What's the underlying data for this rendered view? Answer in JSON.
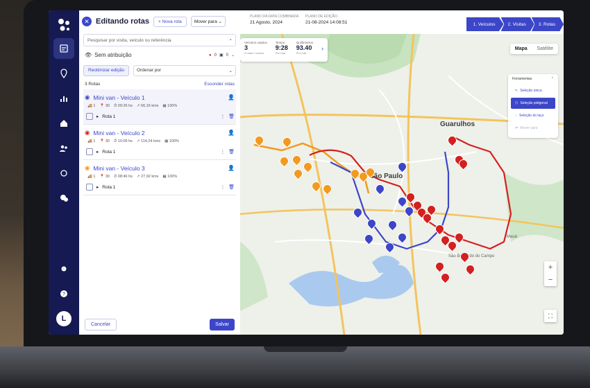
{
  "app": {
    "title": "Editando rotas",
    "new_route_button": "+ Nova rota",
    "move_to_select": "Mover para",
    "plan_name_label": "PLANO DA DATA COMBINADA",
    "plan_date": "21 Agosto, 2024",
    "edited_label": "PLANO DE EDIÇÃO",
    "edited_value": "21-08-2024 14:08:51"
  },
  "steps": [
    "1. Veículos",
    "2. Visitas",
    "3. Rotas"
  ],
  "search": {
    "placeholder": "Pesquisar por visita, veículo ou referência"
  },
  "unassigned": {
    "label": "Sem atribuição",
    "count_a": "0",
    "count_b": "0"
  },
  "actions": {
    "optimize": "Reotimizar edição",
    "sort_placeholder": "Ordenar por"
  },
  "routes_header": {
    "count": "3 Rotas",
    "hide": "Esconder rotas"
  },
  "vehicles": [
    {
      "name": "Mini van - Veículo 1",
      "color": "#3c46c8",
      "stat1": "1",
      "stat2": "30",
      "stat3": "09:26 hs",
      "stat4": "66,16 kms",
      "stat5": "100%",
      "route": "Rota 1"
    },
    {
      "name": "Mini van - Veículo 2",
      "color": "#d32020",
      "stat1": "1",
      "stat2": "30",
      "stat3": "10:05 hs",
      "stat4": "114,24 kms",
      "stat5": "100%",
      "route": "Rota 1"
    },
    {
      "name": "Mini van - Veículo 3",
      "color": "#f29a1f",
      "stat1": "1",
      "stat2": "30",
      "stat3": "08:46 hs",
      "stat4": "27,92 kms",
      "stat5": "100%",
      "route": "Rota 1"
    }
  ],
  "bottom": {
    "cancel": "Cancelar",
    "save": "Salvar"
  },
  "avatar_letter": "L",
  "map_stats": [
    {
      "label": "Veículos usados",
      "value": "3",
      "sub": "3 rotas 0 ocioso"
    },
    {
      "label": "Tempo",
      "value": "9:28",
      "sub": "Por rota"
    },
    {
      "label": "Quilômetros",
      "value": "93.40",
      "sub": "Por rota"
    }
  ],
  "map_type": {
    "map": "Mapa",
    "satellite": "Satélite"
  },
  "tools": {
    "title": "Ferramentas",
    "items": [
      "Seleção única",
      "Seleção poligonal",
      "Seleção do laço",
      "Mover para"
    ]
  },
  "map_labels": {
    "city": "Guarulhos",
    "center": "São Paulo",
    "maua": "Mauá",
    "sbc": "São Bernardo do Campo"
  },
  "colors": {
    "blue": "#3c46c8",
    "red": "#d32020",
    "orange": "#f29a1f",
    "rail": "#151a52"
  }
}
